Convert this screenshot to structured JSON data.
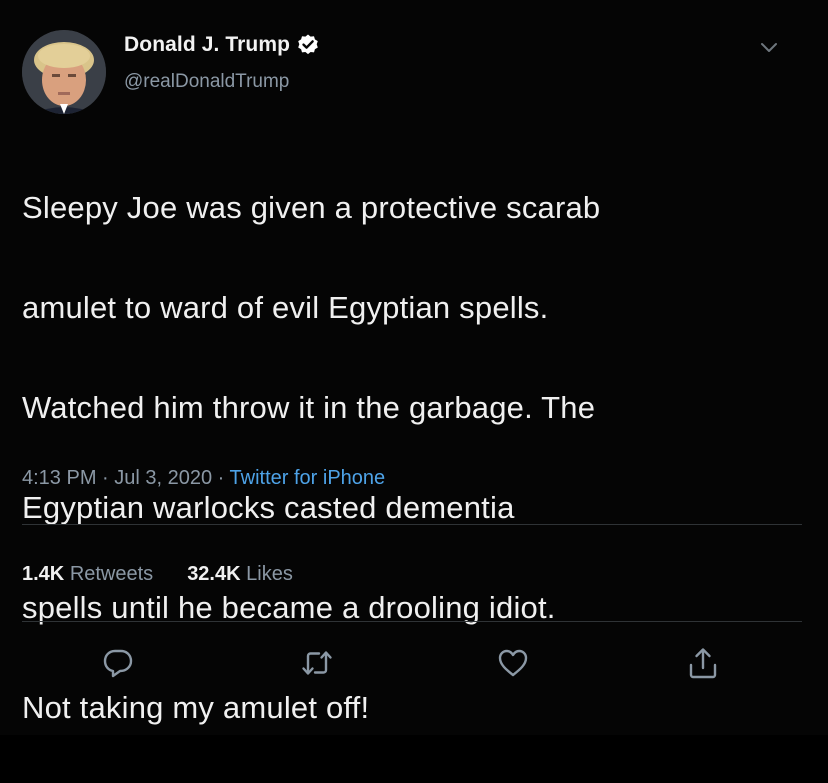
{
  "author": {
    "display_name": "Donald J. Trump",
    "handle": "@realDonaldTrump",
    "verified_icon": "verified-badge-icon"
  },
  "menu": {
    "icon": "chevron-down-icon"
  },
  "tweet": {
    "lines": [
      "Sleepy Joe was given a protective scarab",
      "amulet to ward of evil Egyptian spells.",
      "Watched him throw it in the garbage. The",
      "Egyptian warlocks casted dementia",
      "spells until he became a drooling idiot.",
      "Not taking my amulet off!"
    ]
  },
  "meta": {
    "time": "4:13 PM",
    "separator": " · ",
    "date": "Jul 3, 2020",
    "source": "Twitter for iPhone"
  },
  "stats": {
    "retweets_count": "1.4K",
    "retweets_label": "Retweets",
    "likes_count": "32.4K",
    "likes_label": "Likes"
  },
  "actions": {
    "reply_icon": "reply-icon",
    "retweet_icon": "retweet-icon",
    "like_icon": "heart-icon",
    "share_icon": "share-icon"
  },
  "colors": {
    "background": "#050505",
    "text": "#f0f0f0",
    "secondary": "#8b98a5",
    "link": "#4ea3e8",
    "divider": "#2f3336"
  }
}
